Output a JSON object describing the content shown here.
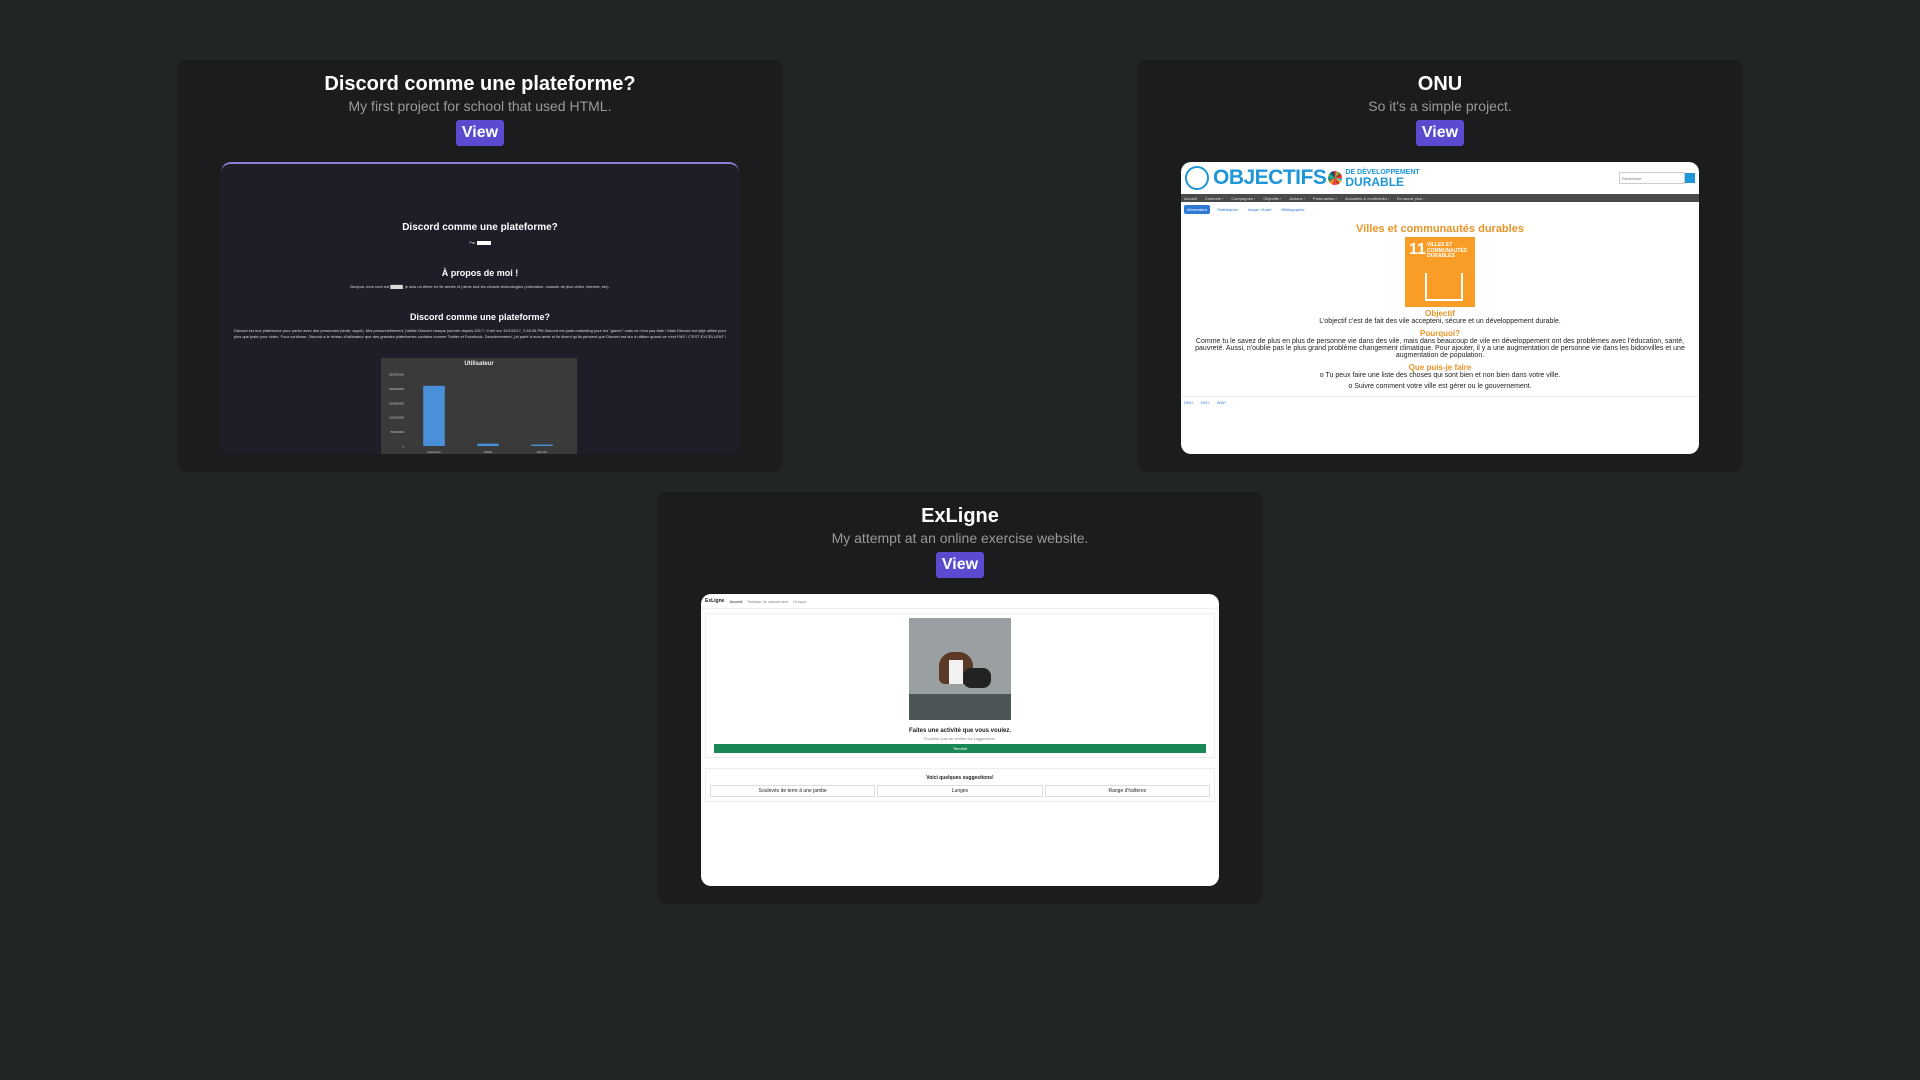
{
  "projects": [
    {
      "title": "Discord comme une plateforme?",
      "subtitle": "My first project for school that used HTML.",
      "view_label": "View",
      "preview": {
        "heading": "Discord comme une plateforme?",
        "by": "Par",
        "about_heading": "À propos de moi !",
        "about_text": "Bonjour, mon nom est ▇▇▇▇, je suis un élève en 9e année et j'aime tout les choses technologies (ordinateur, console de jeux vidéo, internet, etc).",
        "section_heading": "Discord comme une plateforme?",
        "section_text": "Discord est une plateforme pour parler avec des personnes (texte, appel). Moi personnellement, j'utilise Discord chaque journée depuis 2017 ! Créé sur 10/1/2017, 2:46:26 PM Discord est juste marketing pour les \"gamer\" mais ce n'est pas faite ! Mais Discord est déjà utilisé pour plus que juste pour vidéo. Pour continuer, Discord a le niveau d'utilisateur que des grandes plateformes sociales comme Twitter et Facebook. Deuxièmement, j'ai parlé à mon amie et ils disent qu'ils pensent que Discord est dur à utiliser quand ce n'est PAS ! C'EST EXCELLENT !",
        "chart_title": "Utilisateur",
        "chart_yticks": [
          "250000000",
          "200000000",
          "150000000",
          "100000000",
          "50000000",
          "0"
        ],
        "chart_categories": [
          "Facebook",
          "Twitter",
          "Discord"
        ]
      }
    },
    {
      "title": "ONU",
      "subtitle": "So it's a simple project.",
      "view_label": "View",
      "preview": {
        "logo": "OBJECTIFS",
        "logo_sub_1": "DE DÉVELOPPEMENT",
        "logo_sub_2": "DURABLE",
        "search_placeholder": "Recherche",
        "nav": [
          "Accueil",
          "Contexte ›",
          "Campagnes ›",
          "Objectifs ›",
          "Actions ›",
          "Partenariats ›",
          "Actualités & multimédia ›",
          "En savoir plus ›"
        ],
        "tabs": [
          "Information",
          "Statistiques",
          "Image / Autre",
          "Bibliographie"
        ],
        "goal_title": "Villes et communautés durables",
        "goal_number": "11",
        "goal_label": "VILLES ET COMMUNAUTÉS DURABLES",
        "objective_heading": "Objectif",
        "objective_text": "L'objectif c'est de fait des vile accepteni, sécure et un développement durable.",
        "why_heading": "Pourquoi?",
        "why_text": "Comme tu le savez de plus en plus de personne vie dans des vile, mais dans beaucoup de vile en développement ont des problèmes avec l'éducation, santé, pauvreté. Aussi, n'oublie pas le plus grand problème changement climatique. Pour ajouter, il y a une augmentation de personne vie dans les bidonvilles et une augmentation de population.",
        "do_heading": "Que puis-je faire",
        "do_items": [
          "o Tu peux faire une liste des choses qui sont bien et non bien dans votre ville.",
          "o Suivre comment votre ville est gérer ou le gouvernement."
        ],
        "footer_links": [
          "ONU",
          "FAO",
          "WWI"
        ]
      }
    },
    {
      "title": "ExLigne",
      "subtitle": "My attempt at an online exercise website.",
      "view_label": "View",
      "preview": {
        "brand": "ExLigne",
        "nav": [
          "Accueil",
          "Tableau de classement",
          "Groupe"
        ],
        "activity_title": "Faites une activité que vous voulez.",
        "activity_sub": "N'oubliez pas de vérifier les suggestions.",
        "done_button": "Terminé",
        "suggestions_title": "Voici quelques suggestions!",
        "suggestions": [
          "Soulevés de terre à une jambe",
          "Lunges",
          "Range d'haltères"
        ]
      }
    }
  ],
  "chart_data": {
    "type": "bar",
    "title": "Utilisateur",
    "categories": [
      "Facebook",
      "Twitter",
      "Discord"
    ],
    "values": [
      209000000,
      8000000,
      5000000
    ],
    "ylim": [
      0,
      250000000
    ]
  }
}
